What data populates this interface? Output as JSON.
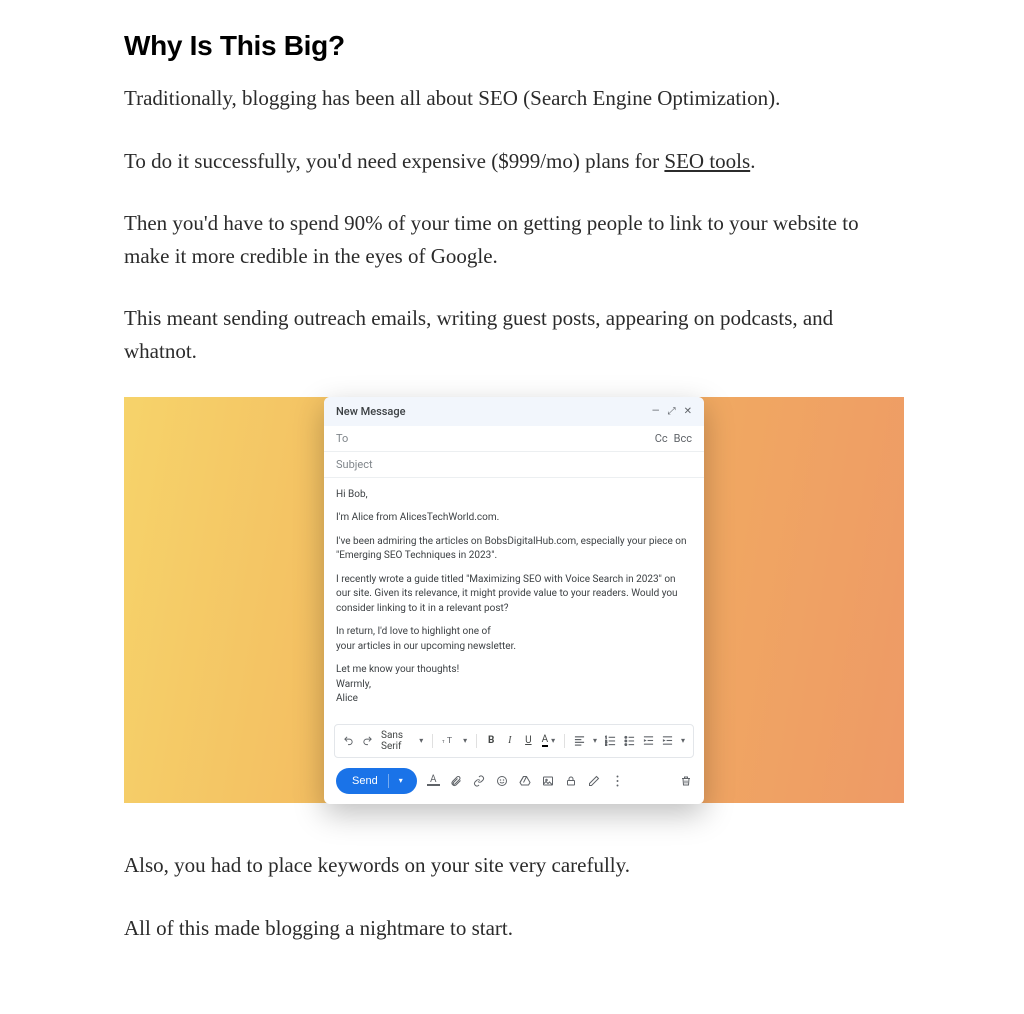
{
  "article": {
    "heading": "Why Is This Big?",
    "p1_pre": "Traditionally, blogging has been all about SEO (Search Engine Optimization).",
    "p2_pre": "To do it successfully, you'd need expensive ($999/mo) plans for ",
    "p2_link": "SEO tools",
    "p2_post": ".",
    "p3": "Then you'd have to spend 90% of your time on getting people to link to your website to make it more credible in the eyes of Google.",
    "p4": "This meant sending outreach emails, writing guest posts, appearing on podcasts, and whatnot.",
    "p5": "Also, you had to place keywords on your site very carefully.",
    "p6": "All of this made blogging a nightmare to start."
  },
  "compose": {
    "title": "New Message",
    "to_label": "To",
    "cc_label": "Cc",
    "bcc_label": "Bcc",
    "subject_placeholder": "Subject",
    "body": {
      "greeting": "Hi Bob,",
      "intro": "I'm Alice from AlicesTechWorld.com.",
      "para1": "I've been admiring the articles on BobsDigitalHub.com, especially your piece on \"Emerging SEO Techniques in 2023\".",
      "para2": "I recently wrote a guide titled \"Maximizing SEO with Voice Search in 2023\" on our site. Given its relevance, it might provide value to your readers. Would you consider linking to it in a relevant post?",
      "para3a": "In return, I'd love to highlight one of",
      "para3b": "your articles in our upcoming newsletter.",
      "closing1": "Let me know your thoughts!",
      "closing2": "Warmly,",
      "closing3": "Alice"
    },
    "format": {
      "font_label": "Sans Serif",
      "bold": "B",
      "italic": "I",
      "underline": "U",
      "text_color": "A"
    },
    "send_label": "Send"
  }
}
